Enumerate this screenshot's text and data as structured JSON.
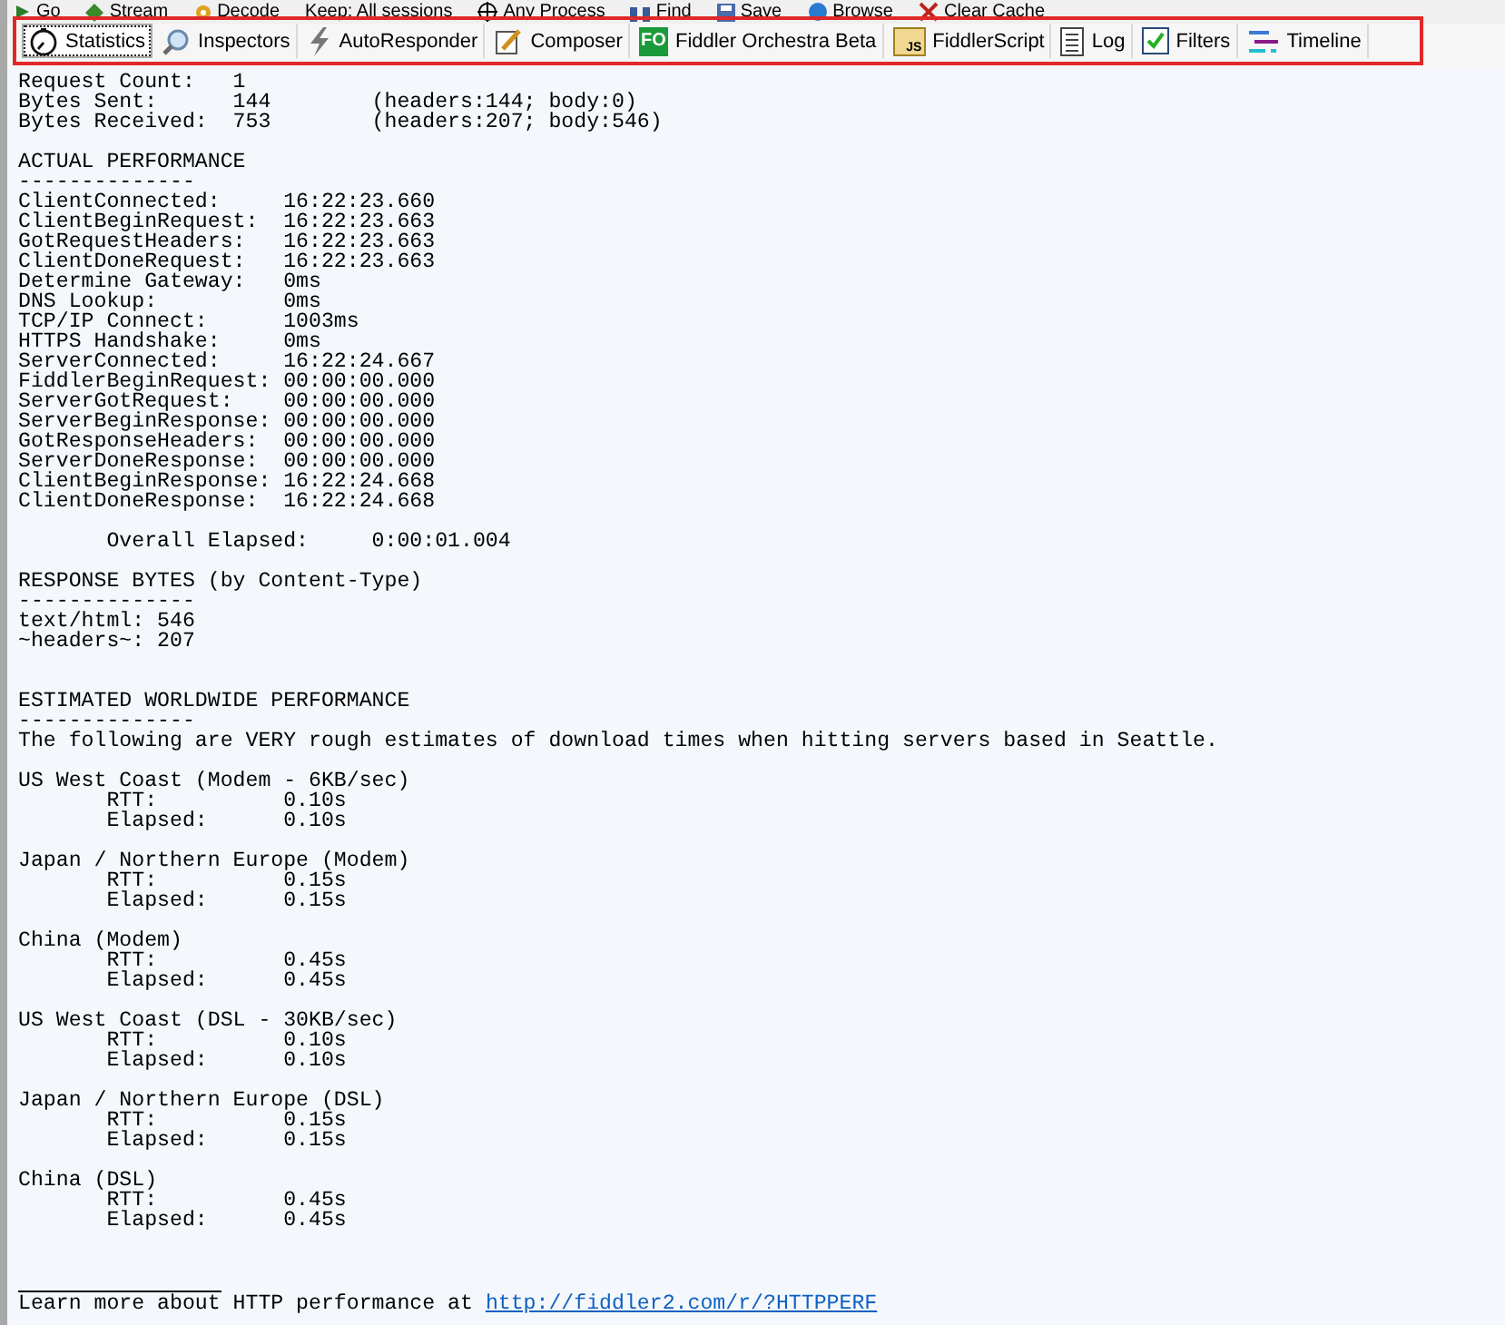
{
  "toolbar": {
    "items": [
      {
        "label": "Go"
      },
      {
        "label": "Stream"
      },
      {
        "label": "Decode"
      },
      {
        "label": "Keep: All sessions"
      },
      {
        "label": "Any Process"
      },
      {
        "label": "Find"
      },
      {
        "label": "Save"
      },
      {
        "label": "Browse"
      },
      {
        "label": "Clear Cache"
      }
    ]
  },
  "tabs": [
    {
      "label": "Statistics",
      "selected": true
    },
    {
      "label": "Inspectors",
      "selected": false
    },
    {
      "label": "AutoResponder",
      "selected": false
    },
    {
      "label": "Composer",
      "selected": false
    },
    {
      "label": "Fiddler Orchestra Beta",
      "icon_text": "FO",
      "selected": false
    },
    {
      "label": "FiddlerScript",
      "icon_text": "JS",
      "selected": false
    },
    {
      "label": "Log",
      "selected": false
    },
    {
      "label": "Filters",
      "selected": false
    },
    {
      "label": "Timeline",
      "selected": false
    }
  ],
  "report": {
    "blocks": [
      {
        "lines": [
          "Request Count:   1",
          "Bytes Sent:      144        (headers:144; body:0)",
          "Bytes Received:  753        (headers:207; body:546)"
        ]
      },
      {
        "lines": [
          "ACTUAL PERFORMANCE",
          "--------------",
          "ClientConnected:     16:22:23.660",
          "ClientBeginRequest:  16:22:23.663",
          "GotRequestHeaders:   16:22:23.663",
          "ClientDoneRequest:   16:22:23.663",
          "Determine Gateway:   0ms",
          "DNS Lookup:          0ms",
          "TCP/IP Connect:      1003ms",
          "HTTPS Handshake:     0ms",
          "ServerConnected:     16:22:24.667",
          "FiddlerBeginRequest: 00:00:00.000",
          "ServerGotRequest:    00:00:00.000",
          "ServerBeginResponse: 00:00:00.000",
          "GotResponseHeaders:  00:00:00.000",
          "ServerDoneResponse:  00:00:00.000",
          "ClientBeginResponse: 16:22:24.668",
          "ClientDoneResponse:  16:22:24.668"
        ]
      },
      {
        "lines": [
          "       Overall Elapsed:     0:00:01.004"
        ]
      },
      {
        "lines": [
          "RESPONSE BYTES (by Content-Type)",
          "--------------",
          "text/html: 546",
          "~headers~: 207"
        ]
      },
      {
        "lines": [
          "ESTIMATED WORLDWIDE PERFORMANCE",
          "--------------",
          "The following are VERY rough estimates of download times when hitting servers based in Seattle."
        ]
      },
      {
        "lines": [
          "US West Coast (Modem - 6KB/sec)",
          "       RTT:          0.10s",
          "       Elapsed:      0.10s"
        ]
      },
      {
        "lines": [
          "Japan / Northern Europe (Modem)",
          "       RTT:          0.15s",
          "       Elapsed:      0.15s"
        ]
      },
      {
        "lines": [
          "China (Modem)",
          "       RTT:          0.45s",
          "       Elapsed:      0.45s"
        ]
      },
      {
        "lines": [
          "US West Coast (DSL - 30KB/sec)",
          "       RTT:          0.10s",
          "       Elapsed:      0.10s"
        ]
      },
      {
        "lines": [
          "Japan / Northern Europe (DSL)",
          "       RTT:          0.15s",
          "       Elapsed:      0.15s"
        ]
      },
      {
        "lines": [
          "China (DSL)",
          "       RTT:          0.45s",
          "       Elapsed:      0.45s"
        ]
      }
    ],
    "footer": {
      "text": "Learn more about HTTP performance at ",
      "link": "http://fiddler2.com/r/?HTTPPERF"
    }
  }
}
